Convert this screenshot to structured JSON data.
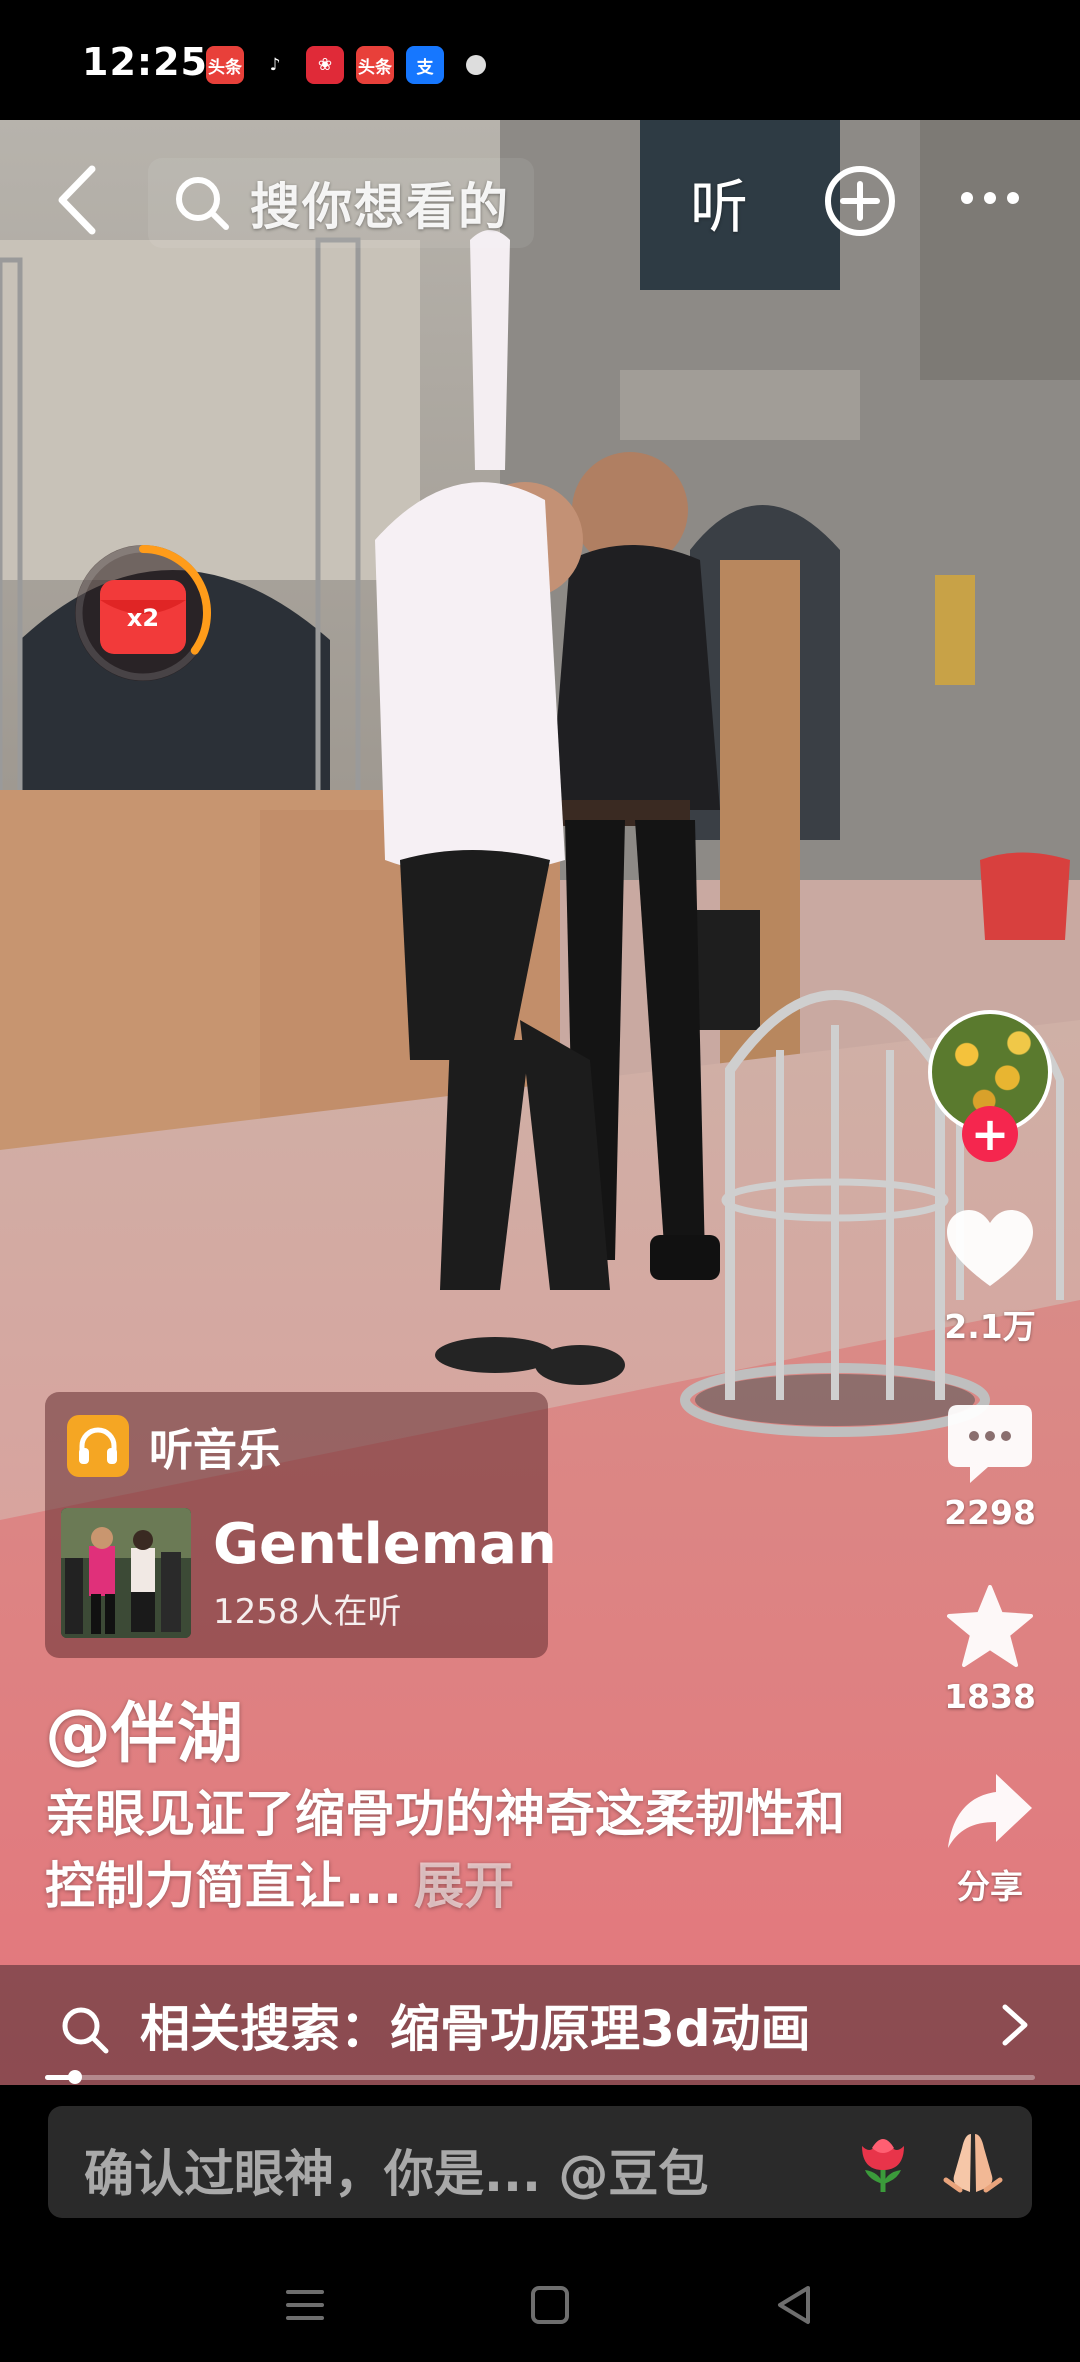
{
  "status_bar": {
    "time": "12:25",
    "apps": [
      {
        "name": "toutiao-icon",
        "label": "头条",
        "color": "#e8403a"
      },
      {
        "name": "tiktok-icon",
        "label": "♪",
        "color": "#000000"
      },
      {
        "name": "dating-app-icon",
        "label": "❀",
        "color": "#e02a38"
      },
      {
        "name": "toutiao-icon-2",
        "label": "头条",
        "color": "#e8403a"
      },
      {
        "name": "alipay-icon",
        "label": "支",
        "color": "#1677ff"
      }
    ]
  },
  "nav": {
    "search_placeholder": "搜你想看的",
    "listen_label": "听"
  },
  "reward": {
    "multiplier": "x2",
    "progress": 0.35
  },
  "actions": {
    "likes": "2.1万",
    "comments": "2298",
    "favorites": "1838",
    "share": "分享"
  },
  "music": {
    "label": "听音乐",
    "song": "Gentleman",
    "listeners": "1258人在听"
  },
  "post": {
    "author": "@伴湖",
    "description": "亲眼见证了缩骨功的神奇这柔韧性和控制力简直让...",
    "expand": "展开"
  },
  "related_search": {
    "text": "相关搜索：缩骨功原理3d动画"
  },
  "video_progress": 0.03,
  "comment": {
    "placeholder": "确认过眼神，你是... @豆包"
  },
  "colors": {
    "accent_red": "#f5264e",
    "music_icon": "#f5a623"
  }
}
